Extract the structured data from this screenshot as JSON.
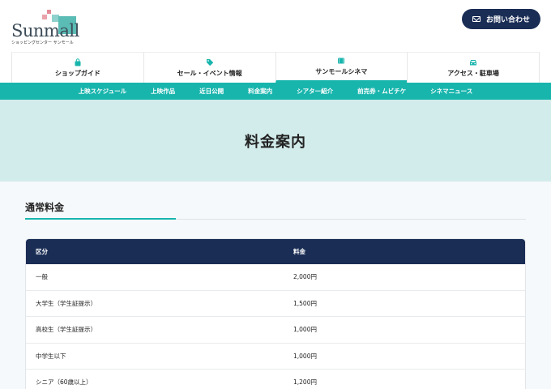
{
  "brand": {
    "logo_text": "Sunmall",
    "logo_sub": "ショッピングセンター サンモール"
  },
  "header": {
    "contact_label": "お問い合わせ"
  },
  "mainnav": [
    {
      "label": "ショップガイド",
      "icon": "shopping-bag-icon"
    },
    {
      "label": "セール・イベント情報",
      "icon": "tag-icon"
    },
    {
      "label": "サンモールシネマ",
      "icon": "film-icon"
    },
    {
      "label": "アクセス・駐車場",
      "icon": "car-icon"
    }
  ],
  "subnav": [
    "上映スケジュール",
    "上映作品",
    "近日公開",
    "料金案内",
    "シアター紹介",
    "前売券・ムビチケ",
    "シネマニュース"
  ],
  "hero": {
    "title": "料金案内"
  },
  "section": {
    "title": "通常料金"
  },
  "table": {
    "headers": [
      "区分",
      "料金"
    ],
    "rows": [
      [
        "一般",
        "2,000円"
      ],
      [
        "大学生（学生証提示）",
        "1,500円"
      ],
      [
        "高校生（学生証提示）",
        "1,000円"
      ],
      [
        "中学生以下",
        "1,000円"
      ],
      [
        "シニア（60歳以上）",
        "1,200円"
      ]
    ]
  },
  "colors": {
    "accent": "#18b5ad",
    "navy": "#1a2d55",
    "hero_bg": "#d2eceb"
  }
}
